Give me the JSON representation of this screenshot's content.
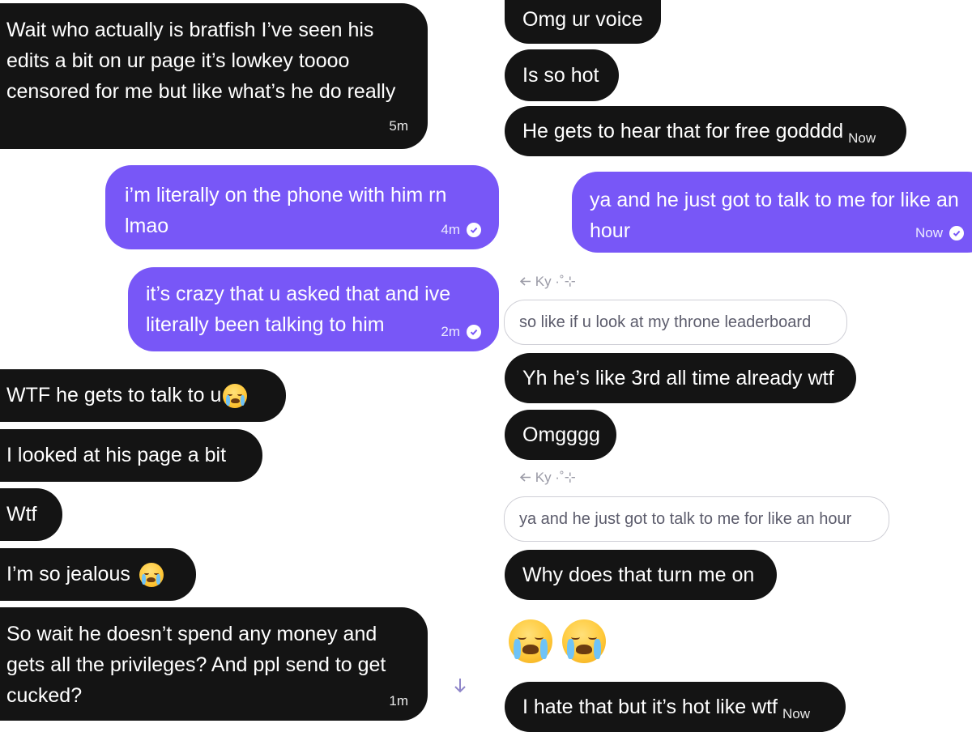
{
  "left_column": {
    "msg1": {
      "text": "Wait who actually is bratfish I’ve seen his edits a bit on ur page it’s lowkey toooo censored for me but like what’s he do really",
      "time": "5m"
    },
    "msg2": {
      "text": "i’m literally on the phone with him rn lmao",
      "time": "4m"
    },
    "msg3": {
      "text": "it’s crazy that u asked that and ive literally been talking to him",
      "time": "2m"
    },
    "msg4": {
      "text": "WTF he gets to talk to u"
    },
    "msg5": {
      "text": "I looked at his page a bit"
    },
    "msg6": {
      "text": "Wtf"
    },
    "msg7": {
      "text": "I’m so jealous"
    },
    "msg8": {
      "text": "So wait he doesn’t spend any money and gets all the privileges? And ppl send to get cucked?",
      "time": "1m"
    }
  },
  "right_column": {
    "msg1": {
      "text": "Omg ur voice"
    },
    "msg2": {
      "text": "Is so hot"
    },
    "msg3": {
      "text": "He gets to hear that for free godddd",
      "time": "Now"
    },
    "msg4": {
      "text": "ya and he just got to talk to me for like an hour",
      "time": "Now"
    },
    "reply1": {
      "label": "Ky ·˚⊹",
      "quote": "so like if u look at my throne leaderboard"
    },
    "msg5": {
      "text": "Yh he’s like 3rd all time already wtf"
    },
    "msg6": {
      "text": "Omgggg"
    },
    "reply2": {
      "label": "Ky ·˚⊹",
      "quote": "ya and he just got to talk to me for like an hour"
    },
    "msg7": {
      "text": "Why does that turn me on"
    },
    "msg8": {
      "text": "I hate that but it’s hot like wtf",
      "time": "Now"
    }
  },
  "icons": {
    "read_receipt": "check-circle-icon",
    "emoji": "loudly-crying-face-icon",
    "reply": "reply-arrow-icon",
    "scroll": "arrow-down-icon"
  },
  "colors": {
    "received_bubble": "#141414",
    "sent_bubble": "#7857f7",
    "quote_border": "#cfcfd6"
  }
}
